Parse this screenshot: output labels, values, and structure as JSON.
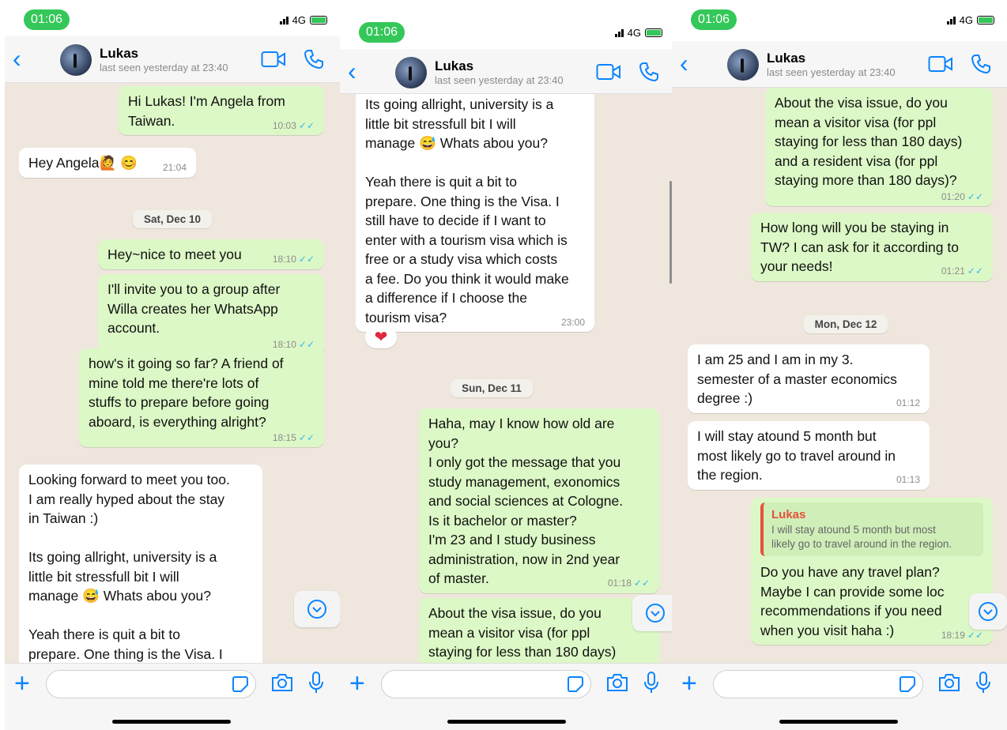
{
  "status": {
    "time": "01:06",
    "network": "4G"
  },
  "header": {
    "back": "‹",
    "name": "Lukas",
    "last_seen": "last seen yesterday at 23:40"
  },
  "icons": {
    "back": "chevron-left-icon",
    "video": "video-call-icon",
    "call": "phone-icon",
    "plus": "plus-icon",
    "sticker": "sticker-icon",
    "camera": "camera-icon",
    "mic": "microphone-icon",
    "scroll": "chevron-down-circle-icon"
  },
  "colors": {
    "outgoing": "#dcf8c6",
    "incoming": "#ffffff",
    "accent": "#0a84ff",
    "read_ticks": "#34b7f1",
    "wallpaper": "#efe7de"
  },
  "screens": [
    {
      "messages": [
        {
          "text": "Hi Lukas! I'm Angela from\nTaiwan.",
          "time": "10:03",
          "ticks": "✓✓"
        },
        {
          "text": "Hey Angela🙋 😊",
          "time": "21:04"
        },
        {
          "text": "Hey~nice to meet you",
          "time": "18:10",
          "ticks": "✓✓"
        },
        {
          "text": "I'll invite you to a group after\nWilla creates her WhatsApp\naccount.",
          "time": "18:10",
          "ticks": "✓✓"
        },
        {
          "text": "how's it going so far? A friend of\nmine told me there're lots of\nstuffs to prepare before going\naboard, is everything alright?",
          "time": "18:15",
          "ticks": "✓✓"
        },
        {
          "text": "Looking forward to meet you too.\nI am really hyped about the stay\nin Taiwan :)\n\nIts going allright, university is a\nlittle bit stressfull bit I will\nmanage 😅 Whats abou you?\n\nYeah there is quit a bit to\nprepare. One thing is the Visa. I"
        }
      ],
      "date": "Sat, Dec 10"
    },
    {
      "messages": [
        {
          "text": "Its going allright, university is a\nlittle bit stressfull bit I will\nmanage 😅 Whats abou you?\n\nYeah there is quit a bit to\nprepare. One thing is the Visa. I\nstill have to decide if I want to\nenter with a tourism visa which is\nfree or a study visa which costs\na fee. Do you think it would make\na difference if I choose the\ntourism visa?",
          "time": "23:00"
        },
        {
          "text": "Haha, may I know how old are\nyou?\nI only got the message that you\nstudy management, exonomics\nand social sciences at Cologne.\nIs it bachelor or master?\nI'm 23 and I study business\nadministration, now in 2nd year\nof master.",
          "time": "01:18",
          "ticks": "✓✓"
        },
        {
          "text": "About the visa issue, do you\nmean a visitor visa (for ppl\nstaying for less than 180 days)"
        }
      ],
      "reaction": "❤",
      "date": "Sun, Dec 11"
    },
    {
      "messages": [
        {
          "text": "About the visa issue, do you\nmean a visitor visa (for ppl\nstaying for less than 180 days)\nand a resident visa (for ppl\nstaying more than 180 days)?",
          "time": "01:20",
          "ticks": "✓✓"
        },
        {
          "text": "How long will you be staying in\nTW? I can ask for it according to\nyour needs!",
          "time": "01:21",
          "ticks": "✓✓"
        },
        {
          "text": "I am 25 and I am in my 3.\nsemester of a master economics\ndegree :)",
          "time": "01:12"
        },
        {
          "text": "I will stay atound 5 month but\nmost likely go to travel around in\nthe region.",
          "time": "01:13"
        },
        {
          "text": "Do you have any travel plan?\nMaybe I can provide some loc\nrecommendations if you need\nwhen you visit haha :)",
          "time": "18:19",
          "ticks": "✓✓",
          "quote": {
            "name": "Lukas",
            "text": "I will stay atound 5 month but most\nlikely go to travel around in the region."
          }
        }
      ],
      "date": "Mon, Dec 12"
    }
  ]
}
